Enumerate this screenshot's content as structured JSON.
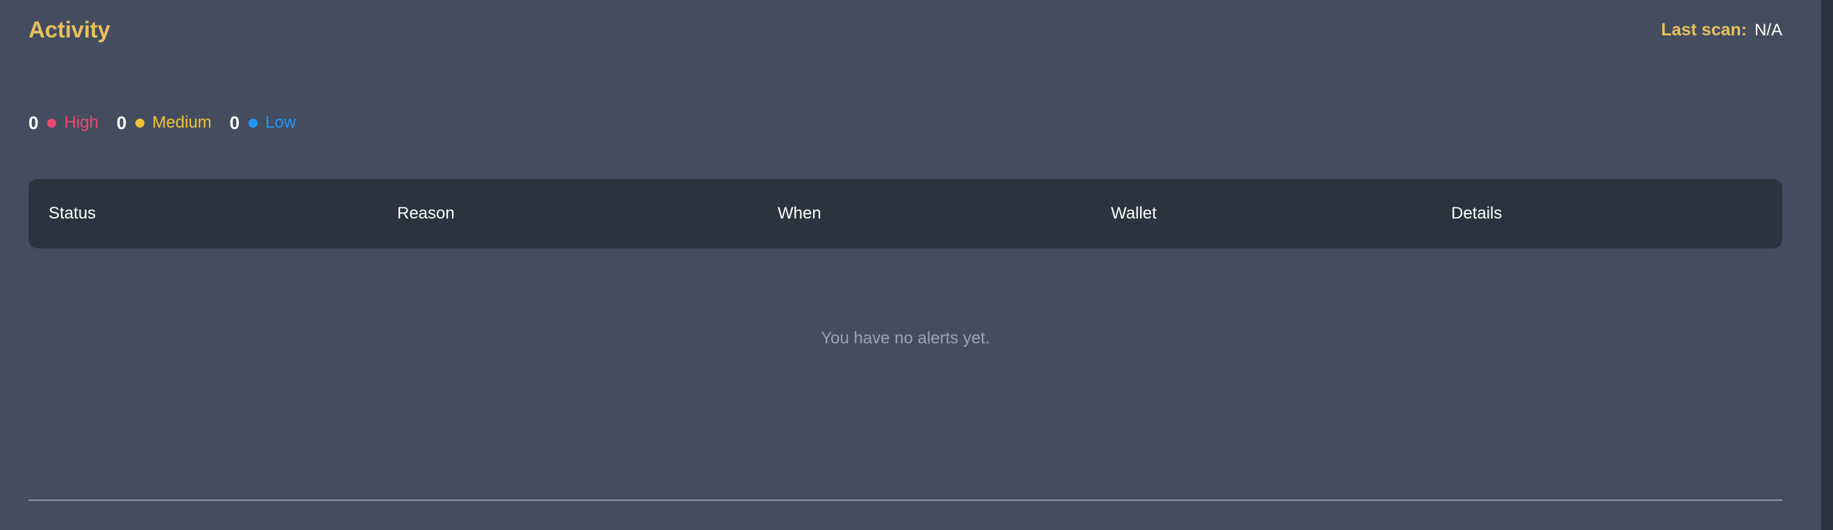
{
  "header": {
    "title": "Activity",
    "last_scan_label": "Last scan:",
    "last_scan_value": "N/A"
  },
  "severity": {
    "items": [
      {
        "count": "0",
        "label": "High",
        "color": "#ef476f",
        "dot_name": "severity-dot-high"
      },
      {
        "count": "0",
        "label": "Medium",
        "color": "#f2c335",
        "dot_name": "severity-dot-medium"
      },
      {
        "count": "0",
        "label": "Low",
        "color": "#2196f3",
        "dot_name": "severity-dot-low"
      }
    ]
  },
  "table": {
    "columns": [
      "Status",
      "Reason",
      "When",
      "Wallet",
      "Details"
    ],
    "rows": [],
    "empty_message": "You have no alerts yet."
  },
  "colors": {
    "page_background": "#434d5f",
    "panel_background": "#2b3340",
    "accent_amber": "#e8c15c",
    "muted_text": "#9aa4b4",
    "divider": "#8c96a6",
    "high": "#ef476f",
    "medium": "#f2c335",
    "low": "#2196f3"
  }
}
